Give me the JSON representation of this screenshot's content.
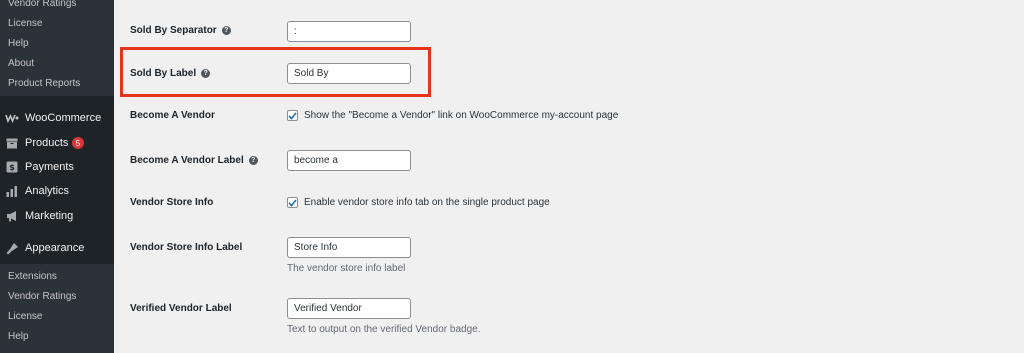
{
  "sidebar": {
    "top_submenu": [
      "Vendor Ratings",
      "License",
      "Help",
      "About",
      "Product Reports"
    ],
    "menu": [
      {
        "label": "WooCommerce",
        "icon": "woocommerce-icon"
      },
      {
        "label": "Products",
        "icon": "products-icon",
        "badge": "5"
      },
      {
        "label": "Payments",
        "icon": "payments-icon"
      },
      {
        "label": "Analytics",
        "icon": "analytics-icon"
      },
      {
        "label": "Marketing",
        "icon": "marketing-icon"
      },
      {
        "label": "Appearance",
        "icon": "appearance-icon"
      }
    ],
    "bottom_submenu": [
      "Extensions",
      "Vendor Ratings",
      "License",
      "Help"
    ]
  },
  "settings": {
    "sold_by_separator": {
      "label": "Sold By Separator",
      "value": ":"
    },
    "sold_by_label": {
      "label": "Sold By Label",
      "value": "Sold By"
    },
    "become_a_vendor": {
      "label": "Become A Vendor",
      "checkbox_text": "Show the \"Become a Vendor\" link on WooCommerce my-account page",
      "checked": true
    },
    "become_a_vendor_label": {
      "label": "Become A Vendor Label",
      "value": "become a"
    },
    "vendor_store_info": {
      "label": "Vendor Store Info",
      "checkbox_text": "Enable vendor store info tab on the single product page",
      "checked": true
    },
    "vendor_store_info_label": {
      "label": "Vendor Store Info Label",
      "value": "Store Info",
      "description": "The vendor store info label"
    },
    "verified_vendor_label": {
      "label": "Verified Vendor Label",
      "value": "Verified Vendor",
      "description": "Text to output on the verified Vendor badge."
    }
  },
  "colors": {
    "sidebar_bg": "#1d2327",
    "submenu_bg": "#2c3338",
    "highlight": "#e8331c",
    "checkbox_accent": "#2271b1",
    "badge": "#d63638"
  }
}
